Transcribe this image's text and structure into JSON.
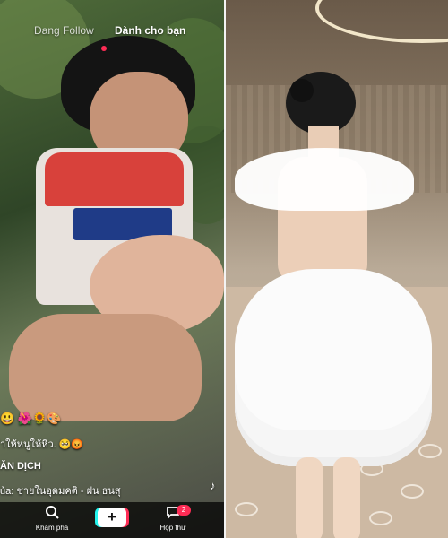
{
  "feed": {
    "tabs": {
      "following": "Đang Follow",
      "for_you": "Dành cho bạn"
    },
    "captions": {
      "emoji_line": "😃 🌺🌻🎨",
      "line2": "ำให้หนูให้หิว. 🥺😡",
      "translate": "ĂN DỊCH",
      "music": "ủa: ชายในอุดมคติ - ฝน ธนสุ"
    },
    "music_icon": "music-note-icon",
    "bottom_nav": {
      "discover_label": "Khám phá",
      "inbox_label": "Hộp thư",
      "inbox_badge": "2",
      "create_symbol": "+"
    }
  },
  "icons": {
    "discover": "search-icon",
    "create": "plus-icon",
    "inbox": "message-icon"
  },
  "colors": {
    "accent_pink": "#fe2c55",
    "accent_cyan": "#25f4ee"
  }
}
